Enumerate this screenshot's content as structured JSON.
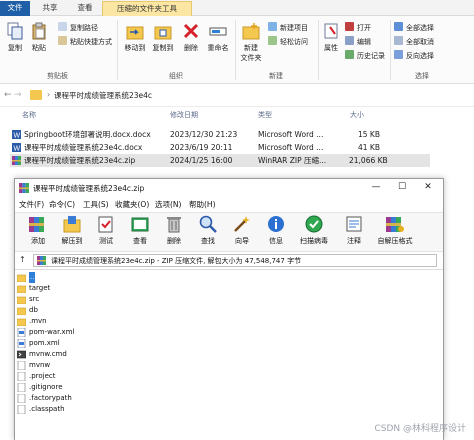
{
  "explorer": {
    "tabs": {
      "file": "文件",
      "share": "共享",
      "view": "查看",
      "tools": "压缩的文件夹工具"
    },
    "ribbon": {
      "copy": "复制",
      "paste": "粘贴",
      "copy_path": "复制路径",
      "paste_shortcut": "粘贴快捷方式",
      "clipboard_group": "剪贴板",
      "move_to": "移动到",
      "copy_to": "复制到",
      "delete": "删除",
      "rename": "重命名",
      "organize_group": "组织",
      "new_item": "新建项目",
      "easy_access": "轻松访问",
      "new_folder": "新建\n文件夹",
      "new_group": "新建",
      "properties": "属性",
      "open": "打开",
      "edit": "编辑",
      "history": "历史记录",
      "select_all": "全部选择",
      "select_none": "全部取消",
      "invert": "反向选择",
      "select_group": "选择"
    },
    "address": {
      "path": "课程平时成绩管理系统23e4c",
      "back": "←",
      "forward": "→",
      "down": "⌄",
      "up": "↑"
    },
    "columns": {
      "name": "名称",
      "modified": "修改日期",
      "type": "类型",
      "size": "大小"
    },
    "files": [
      {
        "name": "Springboot环境部署说明.docx.docx",
        "modified": "2023/12/30 21:23",
        "type": "Microsoft Word ...",
        "size": "15 KB"
      },
      {
        "name": "课程平时成绩管理系统23e4c.docx",
        "modified": "2023/6/19 20:11",
        "type": "Microsoft Word ...",
        "size": "41 KB"
      },
      {
        "name": "课程平时成绩管理系统23e4c.zip",
        "modified": "2024/1/25 16:00",
        "type": "WinRAR ZIP 压缩...",
        "size": "21,066 KB"
      }
    ]
  },
  "winrar": {
    "title": "课程平时成绩管理系统23e4c.zip",
    "controls": {
      "minimize": "—",
      "maximize": "☐",
      "close": "✕"
    },
    "menu": [
      "文件(F)",
      "命令(C)",
      "工具(S)",
      "收藏夹(O)",
      "选项(N)",
      "帮助(H)"
    ],
    "toolbar": [
      "添加",
      "解压到",
      "测试",
      "查看",
      "删除",
      "查找",
      "向导",
      "信息",
      "扫描病毒",
      "注释",
      "自解压格式"
    ],
    "path_text": "课程平时成绩管理系统23e4c.zip - ZIP 压缩文件, 解包大小为 47,548,747 字节",
    "up_arrow": "↑",
    "items": [
      {
        "name": ".."
      },
      {
        "name": "target"
      },
      {
        "name": "src"
      },
      {
        "name": "db"
      },
      {
        "name": ".mvn"
      },
      {
        "name": "pom-war.xml"
      },
      {
        "name": "pom.xml"
      },
      {
        "name": "mvnw.cmd"
      },
      {
        "name": "mvnw"
      },
      {
        "name": ".project"
      },
      {
        "name": ".gitignore"
      },
      {
        "name": ".factorypath"
      },
      {
        "name": ".classpath"
      }
    ]
  },
  "watermark": "CSDN @林科程序设计",
  "colors": {
    "accent": "#1f5fa8",
    "tools_tab": "#fbe6a3",
    "folder": "#f4c84f",
    "selection": "#2f7fd8"
  }
}
